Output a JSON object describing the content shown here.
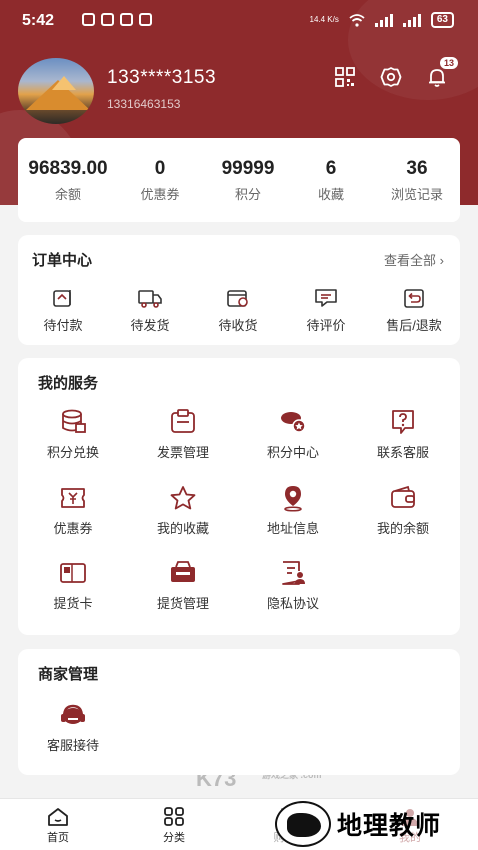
{
  "status_bar": {
    "time": "5:42",
    "net_speed": "14.4 K/s",
    "battery": "63"
  },
  "profile": {
    "name": "133****3153",
    "phone": "13316463153",
    "notification_count": "13"
  },
  "stats": [
    {
      "value": "96839.00",
      "label": "余额"
    },
    {
      "value": "0",
      "label": "优惠券"
    },
    {
      "value": "99999",
      "label": "积分"
    },
    {
      "value": "6",
      "label": "收藏"
    },
    {
      "value": "36",
      "label": "浏览记录"
    }
  ],
  "orders": {
    "title": "订单中心",
    "view_all": "查看全部",
    "items": [
      {
        "label": "待付款",
        "icon": "wallet-pending-icon"
      },
      {
        "label": "待发货",
        "icon": "truck-icon"
      },
      {
        "label": "待收货",
        "icon": "package-clock-icon"
      },
      {
        "label": "待评价",
        "icon": "comment-icon"
      },
      {
        "label": "售后/退款",
        "icon": "refund-icon"
      }
    ]
  },
  "services": {
    "title": "我的服务",
    "items": [
      {
        "label": "积分兑换",
        "icon": "coins-icon"
      },
      {
        "label": "发票管理",
        "icon": "invoice-icon"
      },
      {
        "label": "积分中心",
        "icon": "points-center-icon"
      },
      {
        "label": "联系客服",
        "icon": "help-icon"
      },
      {
        "label": "优惠券",
        "icon": "coupon-icon"
      },
      {
        "label": "我的收藏",
        "icon": "star-icon"
      },
      {
        "label": "地址信息",
        "icon": "location-icon"
      },
      {
        "label": "我的余额",
        "icon": "wallet-icon"
      },
      {
        "label": "提货卡",
        "icon": "card-icon"
      },
      {
        "label": "提货管理",
        "icon": "basket-icon"
      },
      {
        "label": "隐私协议",
        "icon": "privacy-icon"
      }
    ]
  },
  "merchant": {
    "title": "商家管理",
    "items": [
      {
        "label": "客服接待",
        "icon": "headset-icon"
      }
    ]
  },
  "bottom_nav": [
    {
      "label": "首页",
      "icon": "home-icon"
    },
    {
      "label": "分类",
      "icon": "grid-icon"
    },
    {
      "label": "购物车",
      "icon": "cart-icon"
    },
    {
      "label": "我的",
      "icon": "user-icon"
    }
  ],
  "watermark": {
    "text": "地理教师",
    "center_text": "K73",
    "center_sub": "游戏之家 .com"
  },
  "colors": {
    "brand": "#8e2a2c",
    "background": "#f3f3f3"
  }
}
